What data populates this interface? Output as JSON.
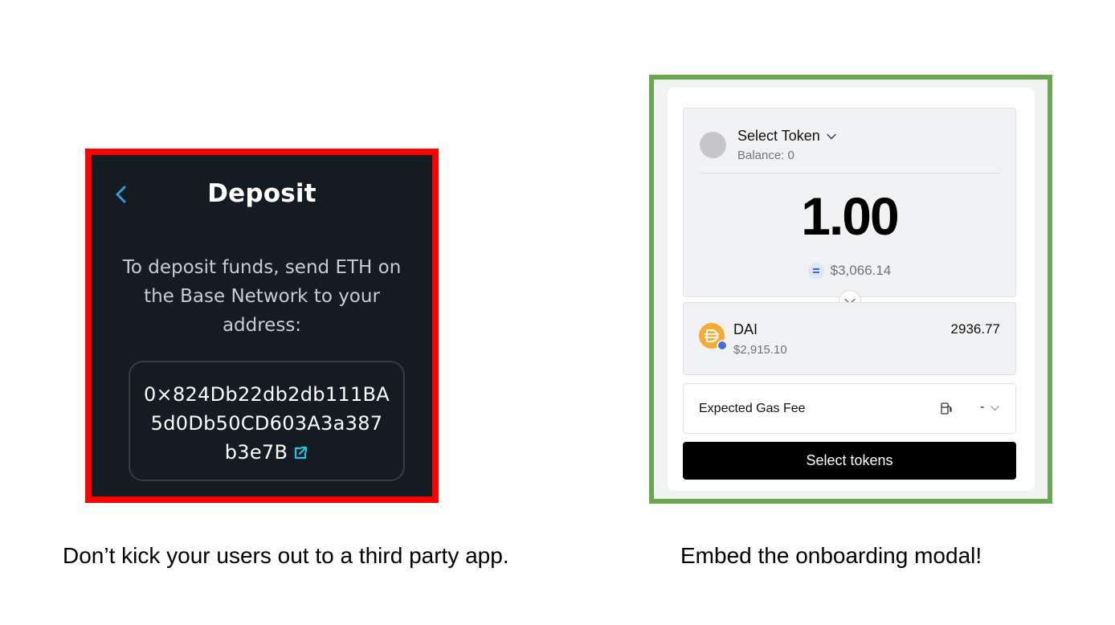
{
  "deposit": {
    "title": "Deposit",
    "instructions": "To deposit funds, send ETH on the Base Network to your address:",
    "address_lines": [
      "0×824Db22db2db111BA",
      "5d0Db50CD603A3a387",
      "b3e7B"
    ]
  },
  "modal": {
    "select_token_label": "Select Token",
    "balance": "Balance: 0",
    "amount": "1.00",
    "amount_usd": "$3,066.14",
    "to_token": {
      "name": "DAI",
      "usd_value": "$2,915.10",
      "amount": "2936.77"
    },
    "gas": {
      "label": "Expected Gas Fee",
      "value": "-"
    },
    "button_label": "Select tokens"
  },
  "captions": {
    "left": "Don’t kick your users out to a third party app.",
    "right": "Embed the onboarding modal!"
  },
  "colors": {
    "left_border": "#ff0000",
    "right_border": "#6aa84f",
    "deposit_bg": "#151b23",
    "accent_blue": "#2f9be0",
    "dai_yellow": "#f5ac37"
  }
}
